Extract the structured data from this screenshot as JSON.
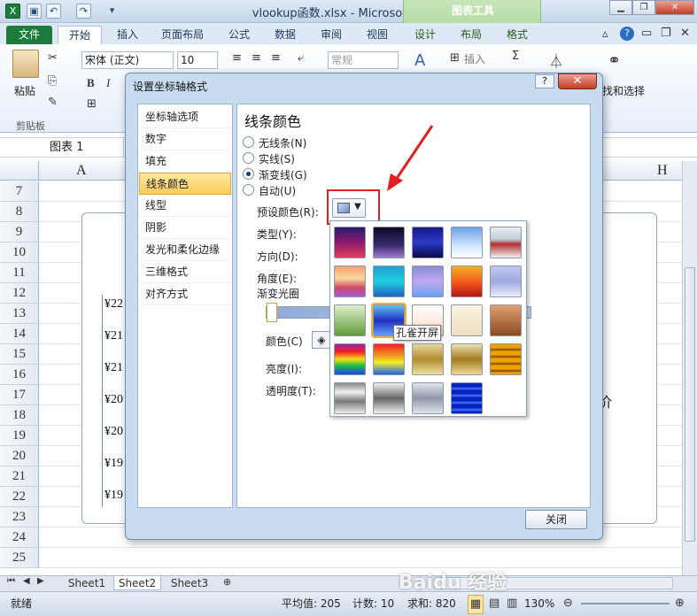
{
  "window": {
    "title": "vlookup函数.xlsx - Microsoft Excel",
    "context_tab_group": "图表工具"
  },
  "tabs": [
    "文件",
    "开始",
    "插入",
    "页面布局",
    "公式",
    "数据",
    "审阅",
    "视图",
    "设计",
    "布局",
    "格式"
  ],
  "ribbon": {
    "paste_label": "粘贴",
    "clipboard_group": "剪贴板",
    "font_name": "宋体 (正文)",
    "font_size": "10",
    "number_format": "常规",
    "insert_label": "插入",
    "find_select": "找和选择"
  },
  "formula_bar": {
    "name_box": "图表 1"
  },
  "grid": {
    "col_left": "A",
    "col_right": "H",
    "rows": [
      "7",
      "8",
      "9",
      "10",
      "11",
      "12",
      "13",
      "14",
      "15",
      "16",
      "17",
      "18",
      "19",
      "20",
      "21",
      "22",
      "23",
      "24",
      "25"
    ],
    "y_labels": [
      "¥22",
      "¥21",
      "¥21",
      "¥20",
      "¥20",
      "¥19",
      "¥19"
    ],
    "right_text": "单价"
  },
  "sheets": [
    "Sheet1",
    "Sheet2",
    "Sheet3"
  ],
  "status": {
    "ready": "就绪",
    "average": "平均值: 205",
    "count": "计数: 10",
    "sum": "求和: 820",
    "zoom": "130%"
  },
  "dialog": {
    "title": "设置坐标轴格式",
    "close_label": "关闭",
    "nav": [
      "坐标轴选项",
      "数字",
      "填充",
      "线条颜色",
      "线型",
      "阴影",
      "发光和柔化边缘",
      "三维格式",
      "对齐方式"
    ],
    "selected_nav": "线条颜色",
    "section_title": "线条颜色",
    "radios": [
      {
        "label": "无线条(N)",
        "checked": false
      },
      {
        "label": "实线(S)",
        "checked": false
      },
      {
        "label": "渐变线(G)",
        "checked": true
      },
      {
        "label": "自动(U)",
        "checked": false
      }
    ],
    "preset_label": "预设颜色(R):",
    "type_label": "类型(Y):",
    "direction_label": "方向(D):",
    "angle_label": "角度(E):",
    "stops_label": "渐变光圈",
    "color_label": "颜色(C)",
    "brightness_label": "亮度(I):",
    "transparency_label": "透明度(T):"
  },
  "gallery": {
    "tooltip": "孔雀开屏",
    "hovered_index": 11
  },
  "colors": {
    "accent": "#1d7c3c",
    "highlight": "#e02020"
  },
  "watermark": "Baidu 经验"
}
